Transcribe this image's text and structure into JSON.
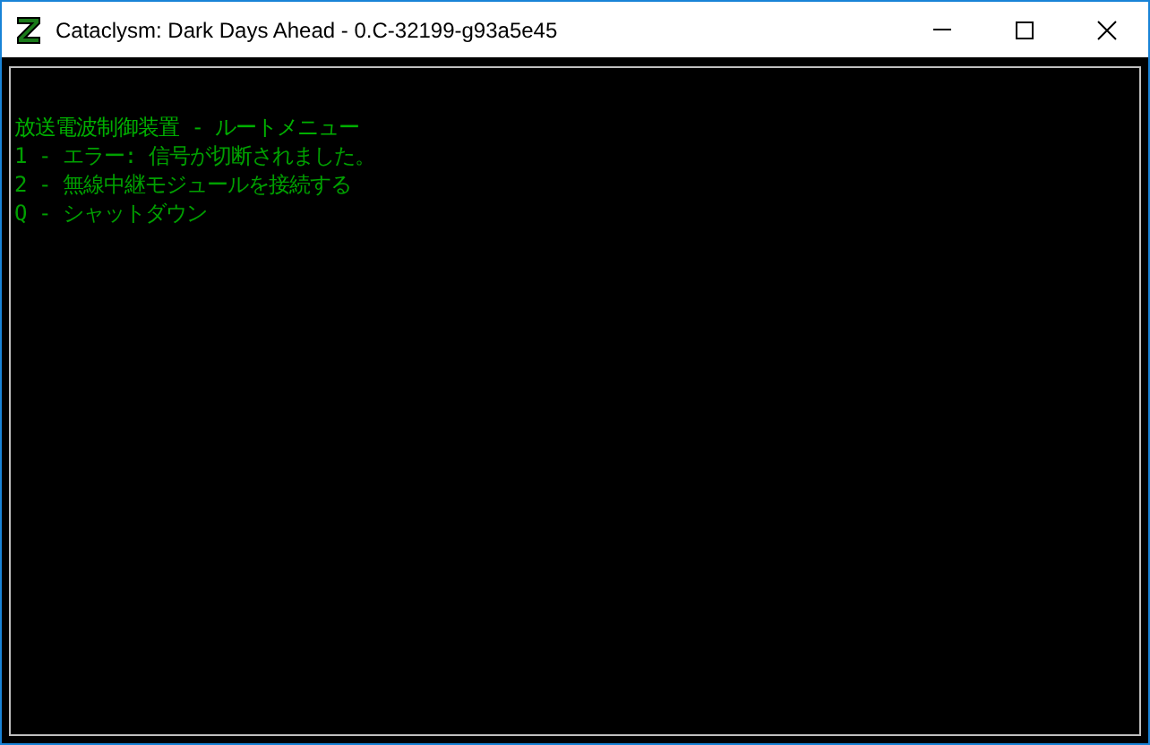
{
  "window": {
    "title": "Cataclysm: Dark Days Ahead - 0.C-32199-g93a5e45"
  },
  "terminal": {
    "lines": [
      {
        "kind": "title",
        "text": "放送電波制御装置 - ルートメニュー"
      },
      {
        "kind": "option",
        "text": "1 - エラー: 信号が切断されました。"
      },
      {
        "kind": "option",
        "text": "2 - 無線中継モジュールを接続する"
      },
      {
        "kind": "option",
        "text": "Q - シャットダウン"
      }
    ]
  }
}
